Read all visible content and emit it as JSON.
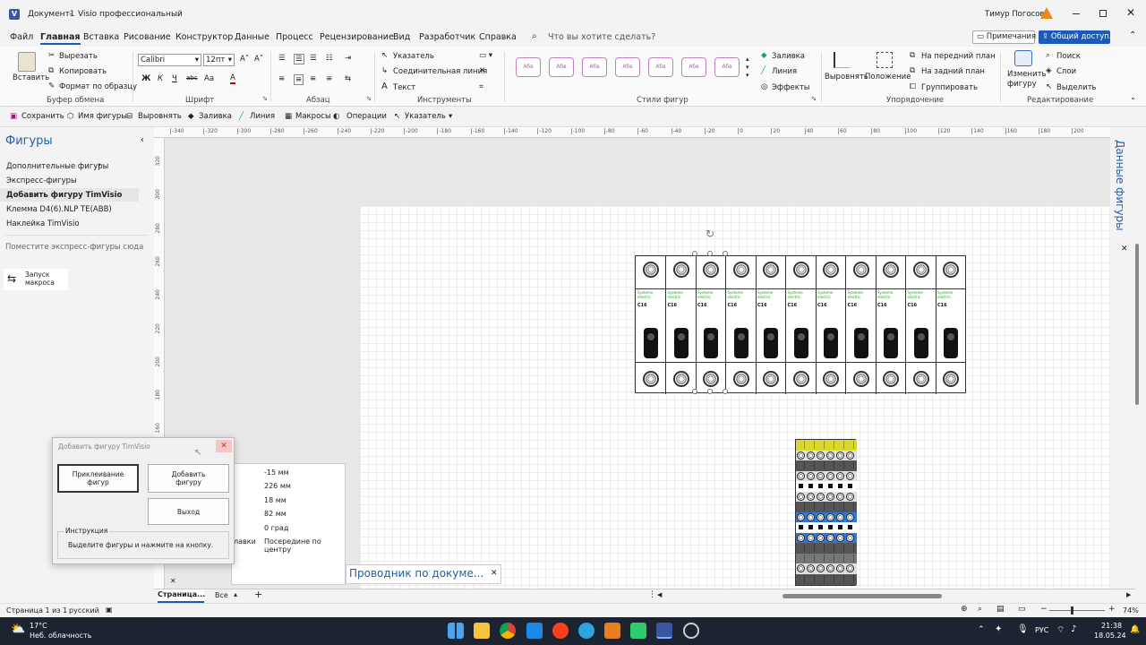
{
  "titlebar": {
    "doc_title": "Документ1",
    "separator": "-",
    "app_name": "Visio профессиональный",
    "user": "Тимур Погосов"
  },
  "menu": [
    "Файл",
    "Главная",
    "Вставка",
    "Рисование",
    "Конструктор",
    "Данные",
    "Процесс",
    "Рецензирование",
    "Вид",
    "Разработчик",
    "Справка"
  ],
  "search_placeholder": "Что вы хотите сделать?",
  "comments_button": "Примечания",
  "share_button": "Общий доступ...",
  "ribbon": {
    "clipboard": {
      "paste": "Вставить",
      "cut": "Вырезать",
      "copy": "Копировать",
      "format_painter": "Формат по образцу",
      "label": "Буфер обмена"
    },
    "font": {
      "name": "Calibri",
      "size": "12пт",
      "label": "Шрифт",
      "bold": "Ж",
      "italic": "К",
      "underline": "Ч",
      "strike": "abc",
      "case": "Aa",
      "color": "A"
    },
    "paragraph": {
      "label": "Абзац"
    },
    "tools": {
      "pointer": "Указатель",
      "connector": "Соединительная линия",
      "text": "Текст",
      "label": "Инструменты"
    },
    "styles": {
      "sample": "Абв",
      "label": "Стили фигур",
      "fill": "Заливка",
      "line": "Линия",
      "effects": "Эффекты"
    },
    "arrange": {
      "align": "Выровнять",
      "position": "Положение",
      "front": "На передний план",
      "back": "На задний план",
      "group": "Группировать",
      "label": "Упорядочение"
    },
    "editing": {
      "change_shape": "Изменить фигуру",
      "find": "Поиск",
      "layers": "Слои",
      "select": "Выделить",
      "label": "Редактирование"
    }
  },
  "qat": {
    "save": "Сохранить",
    "shape_name": "Имя фигуры",
    "align": "Выровнять",
    "fill": "Заливка",
    "line": "Линия",
    "macros": "Макросы",
    "operations": "Операции",
    "pointer": "Указатель"
  },
  "shapes_panel": {
    "title": "Фигуры",
    "items": [
      "Дополнительные фигуры",
      "Экспресс-фигуры",
      "Добавить фигуру TimVisio",
      "Клемма D4(6).NLP TE(ABB)",
      "Наклейка TimVisio"
    ],
    "hint": "Поместите экспресс-фигуры сюда",
    "macro": "Запуск макроса"
  },
  "ruler_top": [
    "-340",
    "-320",
    "-300",
    "-280",
    "-260",
    "-240",
    "-220",
    "-200",
    "-180",
    "-160",
    "-140",
    "-120",
    "-100",
    "-80",
    "-60",
    "-40",
    "-20",
    "0",
    "20",
    "40",
    "60",
    "80",
    "100",
    "120",
    "140",
    "160",
    "180",
    "200"
  ],
  "ruler_left": [
    "320",
    "300",
    "280",
    "260",
    "240",
    "220",
    "200",
    "180",
    "160"
  ],
  "breakers": {
    "count": 11,
    "brand": "Systeme electric",
    "model": "City9 Set MCB",
    "rating": "C16",
    "code": "C9F34116"
  },
  "terminal_block": {
    "columns": 6
  },
  "data_panel_title": "Данные фигуры",
  "dialog": {
    "title": "Добавить фигуру TimVisio",
    "btn_glue": "Приклеивание фигур",
    "btn_add": "Добавить фигуру",
    "btn_exit": "Выход",
    "instruction_label": "Инструкция",
    "instruction_text": "Выделите фигуры и нажмите на кнопку."
  },
  "size_position": {
    "values": [
      "-15 мм",
      "226 мм",
      "18 мм",
      "82 мм",
      "0 град"
    ],
    "pin_label": "лавки",
    "pin_value": "Посередине по центру"
  },
  "navigator": "Проводник по докуме...",
  "page_tabs": {
    "current": "Страница...",
    "all": "Все"
  },
  "status": {
    "page": "Страница 1 из 1",
    "lang": "русский",
    "zoom": "74%"
  },
  "taskbar": {
    "temp": "17°C",
    "weather": "Неб. облачность",
    "lang": "РУС",
    "time": "21:38",
    "date": "18.05.24"
  },
  "colors": {
    "accent": "#185abd",
    "visio_blue": "#3955a3",
    "taskbar": "#1c2331"
  }
}
